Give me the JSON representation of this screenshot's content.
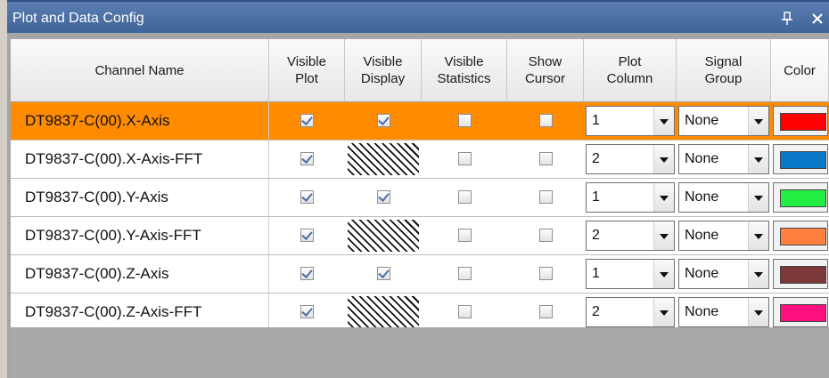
{
  "window": {
    "title": "Plot and Data Config",
    "pin_icon": "pin-icon",
    "close_icon": "close-icon"
  },
  "columns": [
    {
      "label": "Channel Name"
    },
    {
      "label": "Visible\nPlot"
    },
    {
      "label": "Visible\nDisplay"
    },
    {
      "label": "Visible\nStatistics"
    },
    {
      "label": "Show\nCursor"
    },
    {
      "label": "Plot\nColumn"
    },
    {
      "label": "Signal\nGroup"
    },
    {
      "label": "Color"
    }
  ],
  "rows": [
    {
      "name": "DT9837-C(00).X-Axis",
      "selected": true,
      "visible_plot": true,
      "visible_display": "checked",
      "visible_statistics": false,
      "show_cursor": false,
      "plot_column": "1",
      "signal_group": "None",
      "color": "#ff0000"
    },
    {
      "name": "DT9837-C(00).X-Axis-FFT",
      "selected": false,
      "visible_plot": true,
      "visible_display": "unavailable",
      "visible_statistics": false,
      "show_cursor": false,
      "plot_column": "2",
      "signal_group": "None",
      "color": "#0a78c8"
    },
    {
      "name": "DT9837-C(00).Y-Axis",
      "selected": false,
      "visible_plot": true,
      "visible_display": "checked",
      "visible_statistics": false,
      "show_cursor": false,
      "plot_column": "1",
      "signal_group": "None",
      "color": "#22ee44"
    },
    {
      "name": "DT9837-C(00).Y-Axis-FFT",
      "selected": false,
      "visible_plot": true,
      "visible_display": "unavailable",
      "visible_statistics": false,
      "show_cursor": false,
      "plot_column": "2",
      "signal_group": "None",
      "color": "#ff7f3f"
    },
    {
      "name": "DT9837-C(00).Z-Axis",
      "selected": false,
      "visible_plot": true,
      "visible_display": "checked",
      "visible_statistics": false,
      "show_cursor": false,
      "plot_column": "1",
      "signal_group": "None",
      "color": "#7c3838"
    },
    {
      "name": "DT9837-C(00).Z-Axis-FFT",
      "selected": false,
      "visible_plot": true,
      "visible_display": "unavailable",
      "visible_statistics": false,
      "show_cursor": false,
      "plot_column": "2",
      "signal_group": "None",
      "color": "#ff1080"
    }
  ],
  "colors": {
    "title_bar": "#4a6fa8",
    "selected_row": "#ff8c00",
    "empty_area": "#a9a9a9"
  }
}
